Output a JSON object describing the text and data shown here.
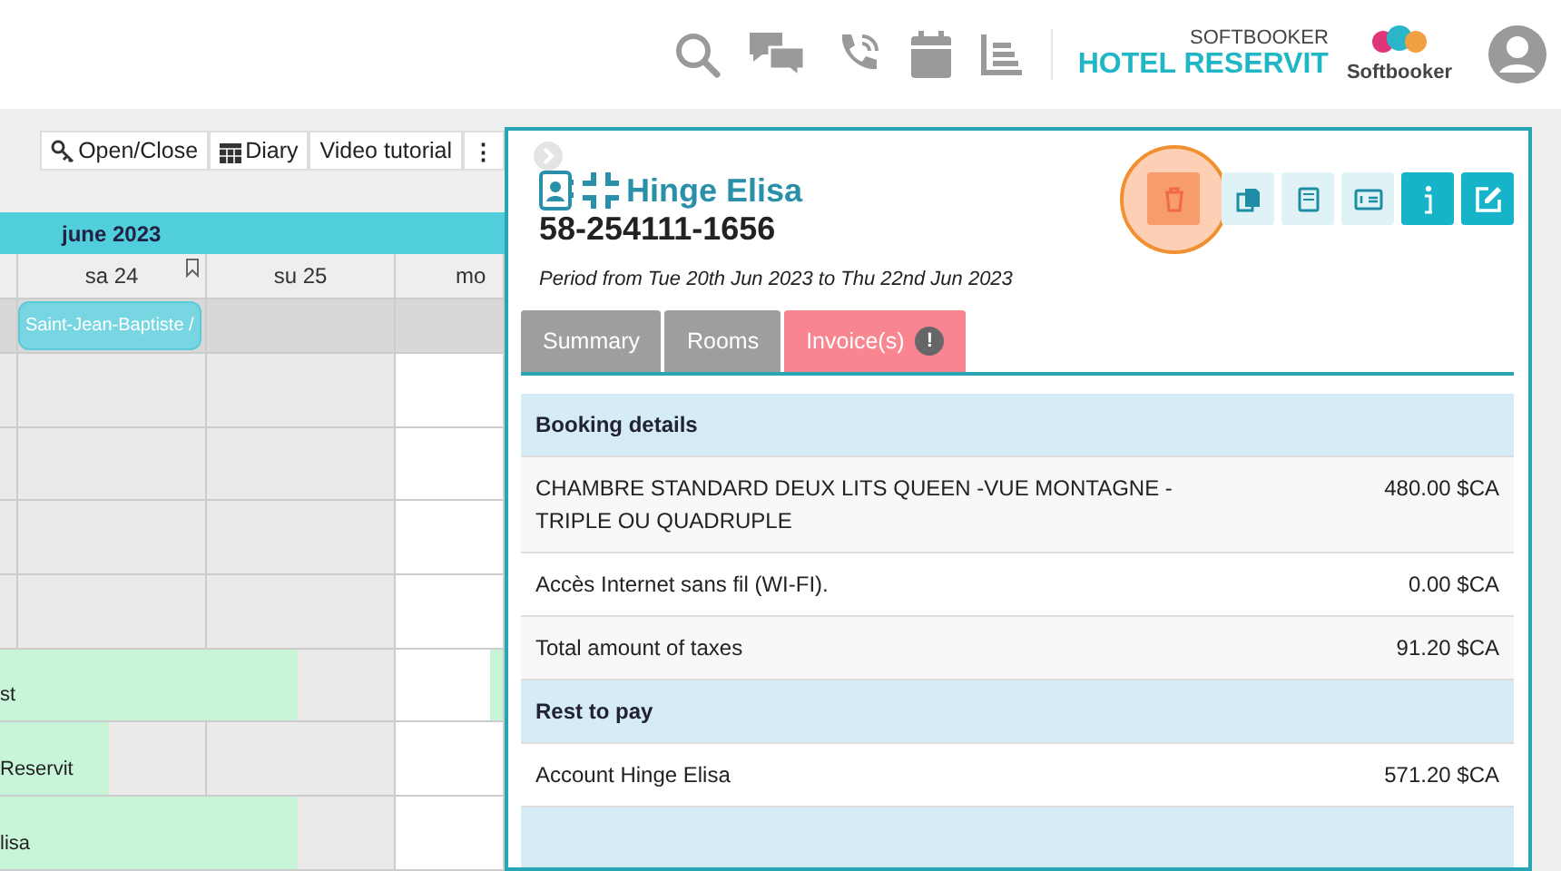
{
  "header": {
    "brand_top": "SOFTBOOKER",
    "brand_name": "HOTEL RESERVIT",
    "logo_text": "Softbooker"
  },
  "toolbar": {
    "buttons": [
      {
        "label": "Open/Close"
      },
      {
        "label": "Diary"
      },
      {
        "label": "Video tutorial"
      }
    ],
    "more": "⋮"
  },
  "calendar": {
    "month": "june 2023",
    "days": [
      "sa 24",
      "su 25",
      "mo"
    ],
    "holiday": "Saint-Jean-Baptiste /",
    "bookings": [
      {
        "label": "st"
      },
      {
        "label": "Reservit"
      },
      {
        "label": "lisa"
      }
    ]
  },
  "panel": {
    "name": "Hinge Elisa",
    "number": "58-254111-1656",
    "period": "Period from Tue 20th Jun 2023 to Thu 22nd Jun 2023",
    "actions": [
      {
        "highlighted": true
      },
      {
        "highlighted": false
      },
      {
        "highlighted": false
      },
      {
        "highlighted": false
      },
      {
        "highlighted": false
      },
      {
        "highlighted": false
      }
    ],
    "tabs": [
      {
        "label": "Summary",
        "selected": false,
        "alert": false
      },
      {
        "label": "Rooms",
        "selected": false,
        "alert": false
      },
      {
        "label": "Invoice(s)",
        "selected": true,
        "alert": true
      }
    ],
    "alert_mark": "!",
    "table": [
      {
        "kind": "section",
        "label": "Booking details"
      },
      {
        "kind": "line",
        "label": "CHAMBRE STANDARD DEUX LITS QUEEN -VUE MONTAGNE - TRIPLE OU QUADRUPLE",
        "amount": "480.00 $CA"
      },
      {
        "kind": "line",
        "label": "Accès Internet sans fil (WI-FI).",
        "amount": "0.00 $CA"
      },
      {
        "kind": "line",
        "label": "Total amount of taxes",
        "amount": "91.20 $CA"
      },
      {
        "kind": "section",
        "label": "Rest to pay"
      },
      {
        "kind": "line",
        "label": "Account Hinge Elisa",
        "amount": "571.20 $CA"
      },
      {
        "kind": "section"
      }
    ]
  }
}
